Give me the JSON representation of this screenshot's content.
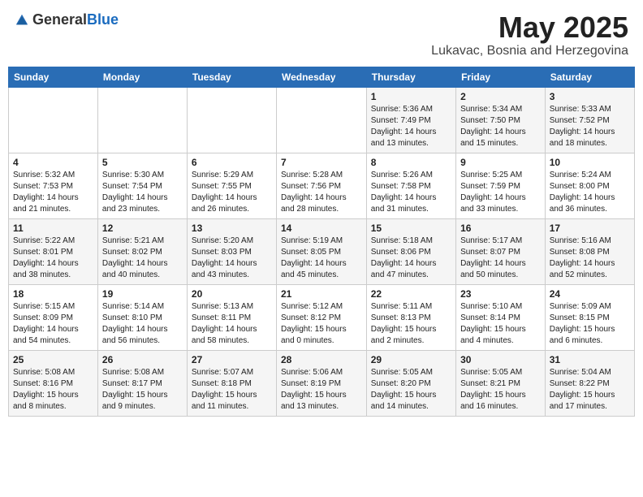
{
  "logo": {
    "text_general": "General",
    "text_blue": "Blue"
  },
  "header": {
    "month": "May 2025",
    "location": "Lukavac, Bosnia and Herzegovina"
  },
  "weekdays": [
    "Sunday",
    "Monday",
    "Tuesday",
    "Wednesday",
    "Thursday",
    "Friday",
    "Saturday"
  ],
  "weeks": [
    [
      {
        "day": "",
        "content": ""
      },
      {
        "day": "",
        "content": ""
      },
      {
        "day": "",
        "content": ""
      },
      {
        "day": "",
        "content": ""
      },
      {
        "day": "1",
        "content": "Sunrise: 5:36 AM\nSunset: 7:49 PM\nDaylight: 14 hours\nand 13 minutes."
      },
      {
        "day": "2",
        "content": "Sunrise: 5:34 AM\nSunset: 7:50 PM\nDaylight: 14 hours\nand 15 minutes."
      },
      {
        "day": "3",
        "content": "Sunrise: 5:33 AM\nSunset: 7:52 PM\nDaylight: 14 hours\nand 18 minutes."
      }
    ],
    [
      {
        "day": "4",
        "content": "Sunrise: 5:32 AM\nSunset: 7:53 PM\nDaylight: 14 hours\nand 21 minutes."
      },
      {
        "day": "5",
        "content": "Sunrise: 5:30 AM\nSunset: 7:54 PM\nDaylight: 14 hours\nand 23 minutes."
      },
      {
        "day": "6",
        "content": "Sunrise: 5:29 AM\nSunset: 7:55 PM\nDaylight: 14 hours\nand 26 minutes."
      },
      {
        "day": "7",
        "content": "Sunrise: 5:28 AM\nSunset: 7:56 PM\nDaylight: 14 hours\nand 28 minutes."
      },
      {
        "day": "8",
        "content": "Sunrise: 5:26 AM\nSunset: 7:58 PM\nDaylight: 14 hours\nand 31 minutes."
      },
      {
        "day": "9",
        "content": "Sunrise: 5:25 AM\nSunset: 7:59 PM\nDaylight: 14 hours\nand 33 minutes."
      },
      {
        "day": "10",
        "content": "Sunrise: 5:24 AM\nSunset: 8:00 PM\nDaylight: 14 hours\nand 36 minutes."
      }
    ],
    [
      {
        "day": "11",
        "content": "Sunrise: 5:22 AM\nSunset: 8:01 PM\nDaylight: 14 hours\nand 38 minutes."
      },
      {
        "day": "12",
        "content": "Sunrise: 5:21 AM\nSunset: 8:02 PM\nDaylight: 14 hours\nand 40 minutes."
      },
      {
        "day": "13",
        "content": "Sunrise: 5:20 AM\nSunset: 8:03 PM\nDaylight: 14 hours\nand 43 minutes."
      },
      {
        "day": "14",
        "content": "Sunrise: 5:19 AM\nSunset: 8:05 PM\nDaylight: 14 hours\nand 45 minutes."
      },
      {
        "day": "15",
        "content": "Sunrise: 5:18 AM\nSunset: 8:06 PM\nDaylight: 14 hours\nand 47 minutes."
      },
      {
        "day": "16",
        "content": "Sunrise: 5:17 AM\nSunset: 8:07 PM\nDaylight: 14 hours\nand 50 minutes."
      },
      {
        "day": "17",
        "content": "Sunrise: 5:16 AM\nSunset: 8:08 PM\nDaylight: 14 hours\nand 52 minutes."
      }
    ],
    [
      {
        "day": "18",
        "content": "Sunrise: 5:15 AM\nSunset: 8:09 PM\nDaylight: 14 hours\nand 54 minutes."
      },
      {
        "day": "19",
        "content": "Sunrise: 5:14 AM\nSunset: 8:10 PM\nDaylight: 14 hours\nand 56 minutes."
      },
      {
        "day": "20",
        "content": "Sunrise: 5:13 AM\nSunset: 8:11 PM\nDaylight: 14 hours\nand 58 minutes."
      },
      {
        "day": "21",
        "content": "Sunrise: 5:12 AM\nSunset: 8:12 PM\nDaylight: 15 hours\nand 0 minutes."
      },
      {
        "day": "22",
        "content": "Sunrise: 5:11 AM\nSunset: 8:13 PM\nDaylight: 15 hours\nand 2 minutes."
      },
      {
        "day": "23",
        "content": "Sunrise: 5:10 AM\nSunset: 8:14 PM\nDaylight: 15 hours\nand 4 minutes."
      },
      {
        "day": "24",
        "content": "Sunrise: 5:09 AM\nSunset: 8:15 PM\nDaylight: 15 hours\nand 6 minutes."
      }
    ],
    [
      {
        "day": "25",
        "content": "Sunrise: 5:08 AM\nSunset: 8:16 PM\nDaylight: 15 hours\nand 8 minutes."
      },
      {
        "day": "26",
        "content": "Sunrise: 5:08 AM\nSunset: 8:17 PM\nDaylight: 15 hours\nand 9 minutes."
      },
      {
        "day": "27",
        "content": "Sunrise: 5:07 AM\nSunset: 8:18 PM\nDaylight: 15 hours\nand 11 minutes."
      },
      {
        "day": "28",
        "content": "Sunrise: 5:06 AM\nSunset: 8:19 PM\nDaylight: 15 hours\nand 13 minutes."
      },
      {
        "day": "29",
        "content": "Sunrise: 5:05 AM\nSunset: 8:20 PM\nDaylight: 15 hours\nand 14 minutes."
      },
      {
        "day": "30",
        "content": "Sunrise: 5:05 AM\nSunset: 8:21 PM\nDaylight: 15 hours\nand 16 minutes."
      },
      {
        "day": "31",
        "content": "Sunrise: 5:04 AM\nSunset: 8:22 PM\nDaylight: 15 hours\nand 17 minutes."
      }
    ]
  ]
}
